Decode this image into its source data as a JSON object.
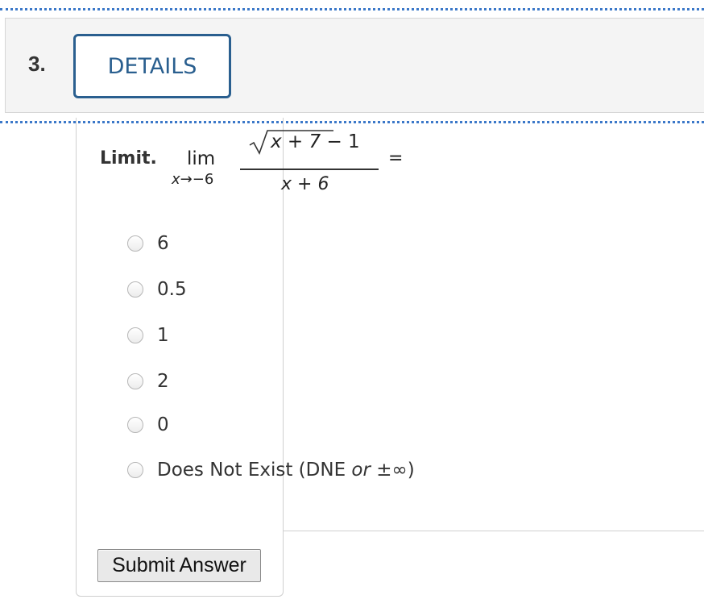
{
  "question": {
    "number": "3.",
    "details_label": "DETAILS",
    "stem_label": "Limit.",
    "limit": {
      "operator": "lim",
      "subscript_var": "x",
      "subscript_arrow": "→",
      "subscript_value": "−6",
      "numerator_radicand": "x + 7",
      "numerator_tail": " − 1",
      "denominator": "x + 6",
      "equals": "="
    }
  },
  "options": [
    {
      "label": "6"
    },
    {
      "label": "0.5"
    },
    {
      "label": "1"
    },
    {
      "label": "2"
    },
    {
      "label": "0"
    },
    {
      "label_prefix": "Does Not Exist (DNE ",
      "label_italic": "or",
      "label_suffix": " ±∞)"
    }
  ],
  "submit_label": "Submit Answer",
  "colors": {
    "accent": "#2a5f8f",
    "dotted_rule": "#3b78c9",
    "header_bg": "#f4f4f4"
  }
}
